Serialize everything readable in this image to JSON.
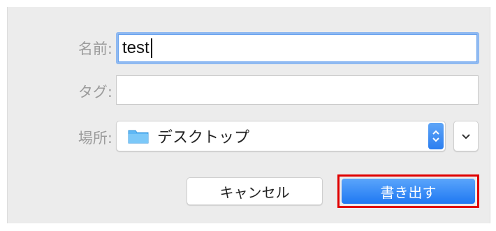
{
  "form": {
    "name_label": "名前:",
    "name_value": "test",
    "tag_label": "タグ:",
    "tag_value": "",
    "location_label": "場所:",
    "location_value": "デスクトップ"
  },
  "buttons": {
    "cancel_label": "キャンセル",
    "export_label": "書き出す"
  },
  "colors": {
    "accent": "#1f78f2",
    "highlight_border": "#e00000",
    "folder": "#5fb8f5"
  }
}
